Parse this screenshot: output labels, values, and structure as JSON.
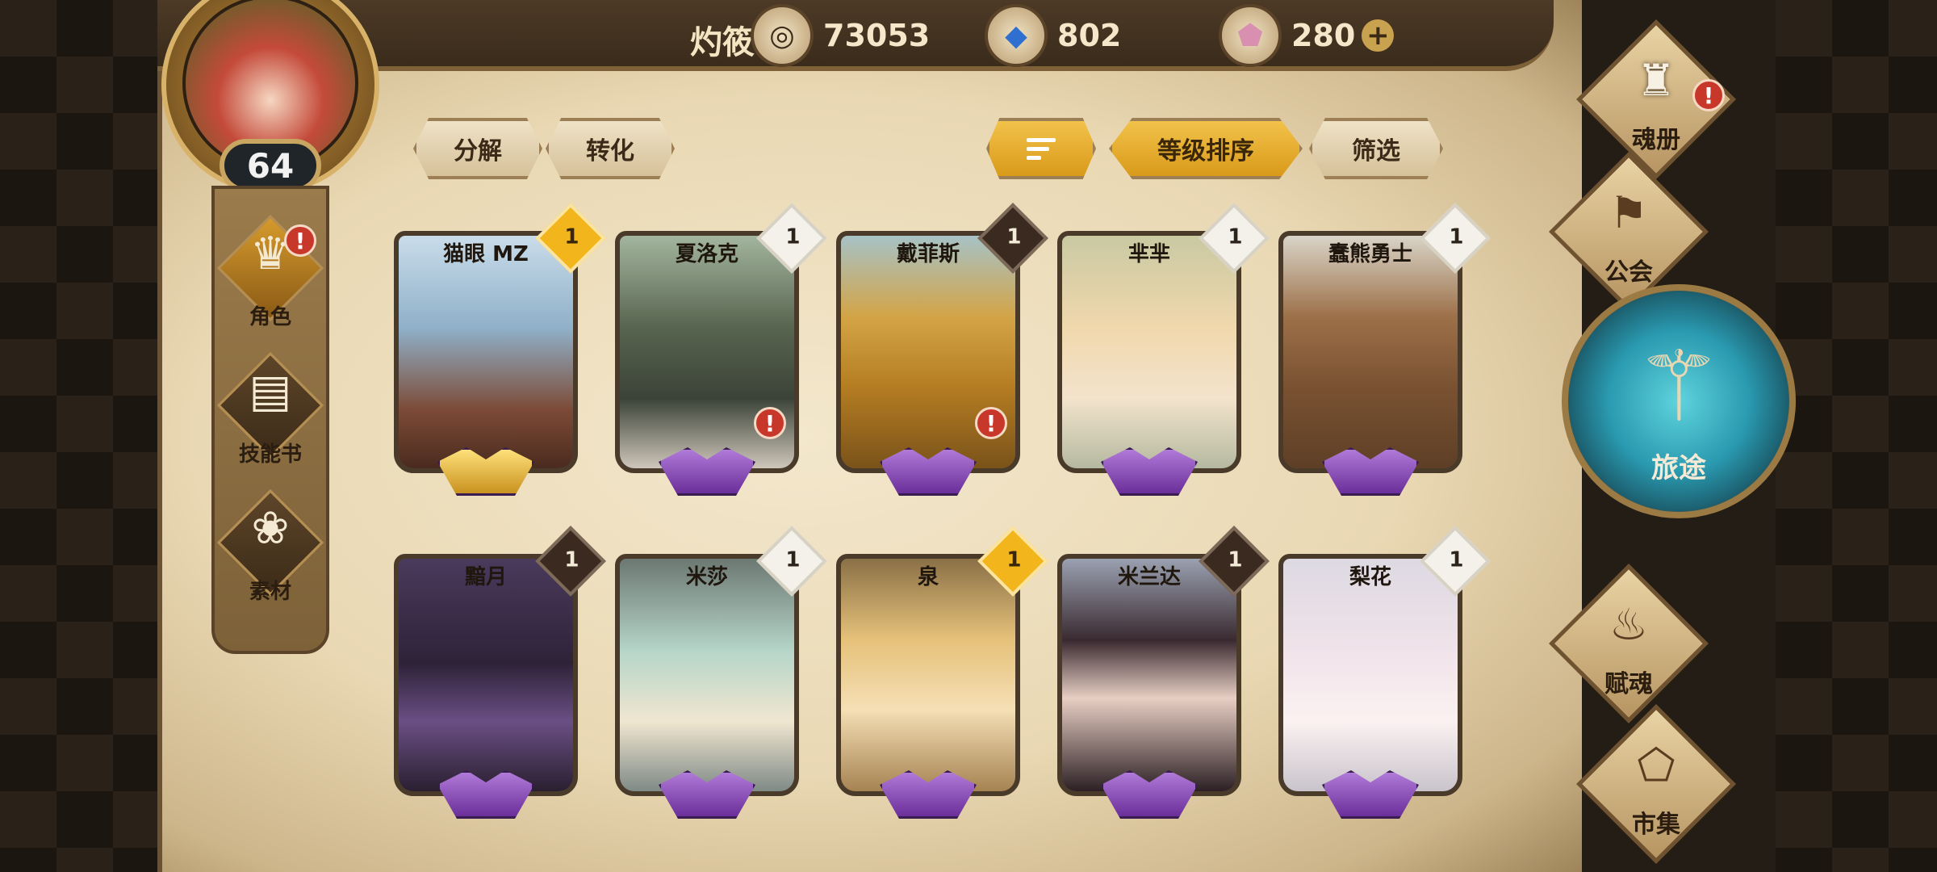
{
  "topbar": {
    "player_name": "灼筱",
    "currencies": [
      {
        "icon": "coin-icon",
        "value": "73053"
      },
      {
        "icon": "blue-crystal-icon",
        "value": "802"
      },
      {
        "icon": "pink-gem-icon",
        "value": "280"
      }
    ],
    "plus_label": "+"
  },
  "player": {
    "level": "64"
  },
  "left_menu": [
    {
      "label": "角色",
      "icon": "character-icon",
      "active": true,
      "alert": "!"
    },
    {
      "label": "技能书",
      "icon": "skill-book-icon",
      "active": false
    },
    {
      "label": "素材",
      "icon": "material-icon",
      "active": false
    }
  ],
  "toolbar": {
    "decompose": "分解",
    "convert": "转化",
    "sort_by": "等级排序",
    "filter": "筛选"
  },
  "cards": [
    {
      "name": "猫眼 MZ",
      "level": "1",
      "badge": "gold",
      "gem": "gold",
      "alert": false
    },
    {
      "name": "夏洛克",
      "level": "1",
      "badge": "white",
      "gem": "purple",
      "alert": true
    },
    {
      "name": "戴菲斯",
      "level": "1",
      "badge": "dark",
      "gem": "purple",
      "alert": true
    },
    {
      "name": "芈芈",
      "level": "1",
      "badge": "white",
      "gem": "purple",
      "alert": false
    },
    {
      "name": "蠢熊勇士",
      "level": "1",
      "badge": "white",
      "gem": "purple",
      "alert": false
    },
    {
      "name": "黯月",
      "level": "1",
      "badge": "dark",
      "gem": "purple",
      "alert": false
    },
    {
      "name": "米莎",
      "level": "1",
      "badge": "white",
      "gem": "purple",
      "alert": false
    },
    {
      "name": "泉",
      "level": "1",
      "badge": "gold",
      "gem": "purple",
      "alert": false
    },
    {
      "name": "米兰达",
      "level": "1",
      "badge": "dark",
      "gem": "purple",
      "alert": false
    },
    {
      "name": "梨花",
      "level": "1",
      "badge": "white",
      "gem": "purple",
      "alert": false
    }
  ],
  "right_menu": {
    "soul_book": "魂册",
    "guild": "公会",
    "journey": "旅途",
    "endow_soul": "赋魂",
    "market": "市集"
  },
  "alert_mark": "!"
}
